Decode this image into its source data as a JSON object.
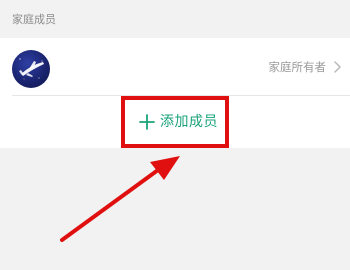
{
  "section": {
    "title": "家庭成员"
  },
  "members": [
    {
      "role": "家庭所有者",
      "avatar_icon": "airplane-avatar-icon"
    }
  ],
  "actions": {
    "add_member_label": "添加成员",
    "add_icon": "plus-icon"
  },
  "annotation": {
    "color": "#e01010"
  },
  "colors": {
    "accent": "#1aa37a",
    "background": "#f2f2f2",
    "card": "#ffffff",
    "secondary_text": "#9a9a9a"
  }
}
